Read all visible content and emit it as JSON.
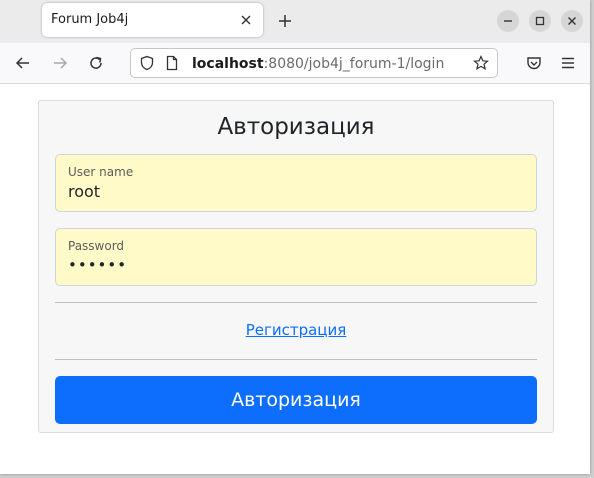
{
  "browser": {
    "tab_title": "Forum Job4j",
    "url_host": "localhost",
    "url_path": ":8080/job4j_forum-1/login"
  },
  "login_form": {
    "title": "Авторизация",
    "username_label": "User name",
    "username_value": "root",
    "password_label": "Password",
    "password_value": "••••••",
    "register_link": "Регистрация",
    "submit_label": "Авторизация"
  },
  "colors": {
    "primary": "#0d6efd",
    "autofill": "#fffac8"
  }
}
